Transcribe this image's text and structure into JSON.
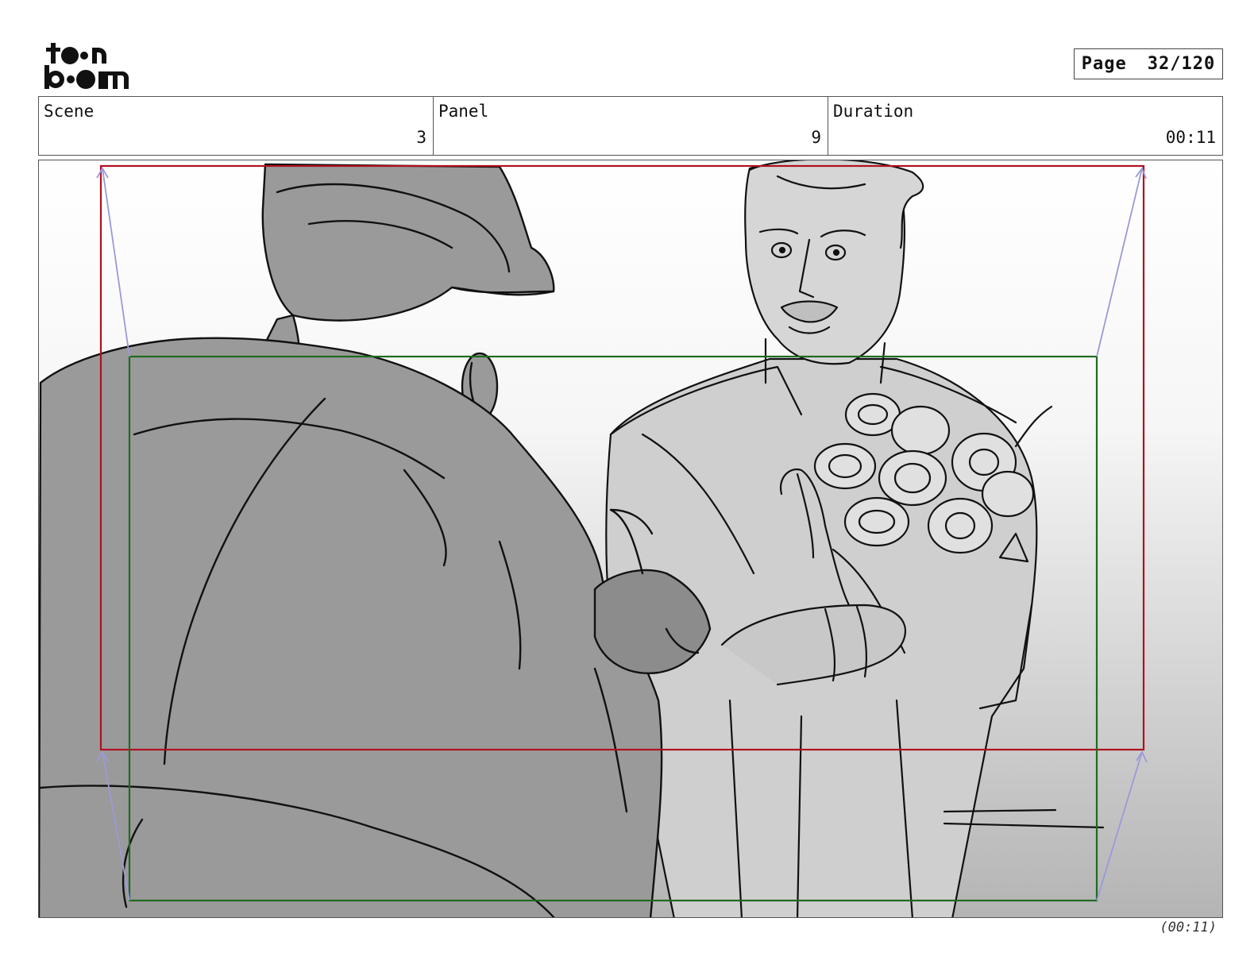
{
  "logo": {
    "line1": "to•n",
    "line2": "b•om",
    "alt": "toonboom-logo"
  },
  "page": {
    "label": "Page",
    "value": "32/120"
  },
  "info": {
    "scene": {
      "label": "Scene",
      "value": "3"
    },
    "panel": {
      "label": "Panel",
      "value": "9"
    },
    "duration": {
      "label": "Duration",
      "value": "00:11"
    }
  },
  "panel_image": {
    "icon": "storyboard-sketch"
  },
  "footer": {
    "duration": "(00:11)"
  },
  "colors": {
    "camera_start_frame": "#b01020",
    "camera_end_frame": "#1e6b1e",
    "camera_path": "#9a9ad8",
    "foreground_character": "#9a9a9a",
    "background_character": "#cfcfcf"
  }
}
